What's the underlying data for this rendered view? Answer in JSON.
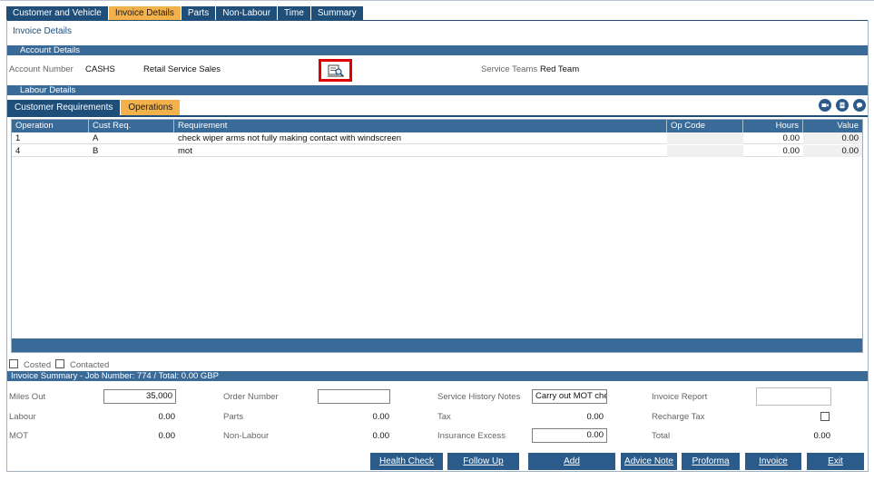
{
  "tabs": [
    "Customer and Vehicle",
    "Invoice Details",
    "Parts",
    "Non-Labour",
    "Time",
    "Summary"
  ],
  "active_tab": "Invoice Details",
  "page_title": "Invoice Details",
  "account_section": {
    "title": "Account Details",
    "account_number_label": "Account Number",
    "account_number": "CASHS",
    "account_name": "Retail Service Sales",
    "lookup_icon": "account-lookup-icon",
    "service_teams_label": "Service Teams",
    "service_teams": "Red Team"
  },
  "labour_section": {
    "title": "Labour Details",
    "subtabs": [
      "Customer Requirements",
      "Operations"
    ],
    "active_subtab": "Operations",
    "icons": [
      "video-icon",
      "document-icon",
      "chat-icon"
    ],
    "columns": [
      "Operation",
      "Cust Req.",
      "Requirement",
      "Op Code",
      "Hours",
      "Value"
    ],
    "rows": [
      {
        "operation": "1",
        "cust_req": "A",
        "requirement": "check wiper arms not fully making contact with windscreen",
        "op_code": "",
        "hours": "0.00",
        "value": "0.00"
      },
      {
        "operation": "4",
        "cust_req": "B",
        "requirement": "mot",
        "op_code": "",
        "hours": "0.00",
        "value": "0.00"
      }
    ]
  },
  "flags": {
    "costed_label": "Costed",
    "costed": false,
    "contacted_label": "Contacted",
    "contacted": false
  },
  "summary": {
    "title": "Invoice Summary - Job Number: 774 / Total: 0.00 GBP",
    "miles_out_label": "Miles Out",
    "miles_out": "35,000",
    "order_number_label": "Order Number",
    "order_number": "",
    "service_history_label": "Service History Notes",
    "service_history": "Carry out MOT che",
    "invoice_report_label": "Invoice Report",
    "invoice_report": "",
    "labour_label": "Labour",
    "labour": "0.00",
    "parts_label": "Parts",
    "parts": "0.00",
    "tax_label": "Tax",
    "tax": "0.00",
    "recharge_tax_label": "Recharge Tax",
    "recharge_tax": false,
    "mot_label": "MOT",
    "mot": "0.00",
    "non_labour_label": "Non-Labour",
    "non_labour": "0.00",
    "insurance_excess_label": "Insurance Excess",
    "insurance_excess": "0.00",
    "total_label": "Total",
    "total": "0.00"
  },
  "buttons": {
    "health_check": "Health Check",
    "follow_up": "Follow Up",
    "add": "Add",
    "advice_note": "Advice Note",
    "proforma": "Proforma",
    "invoice": "Invoice",
    "exit": "Exit"
  }
}
